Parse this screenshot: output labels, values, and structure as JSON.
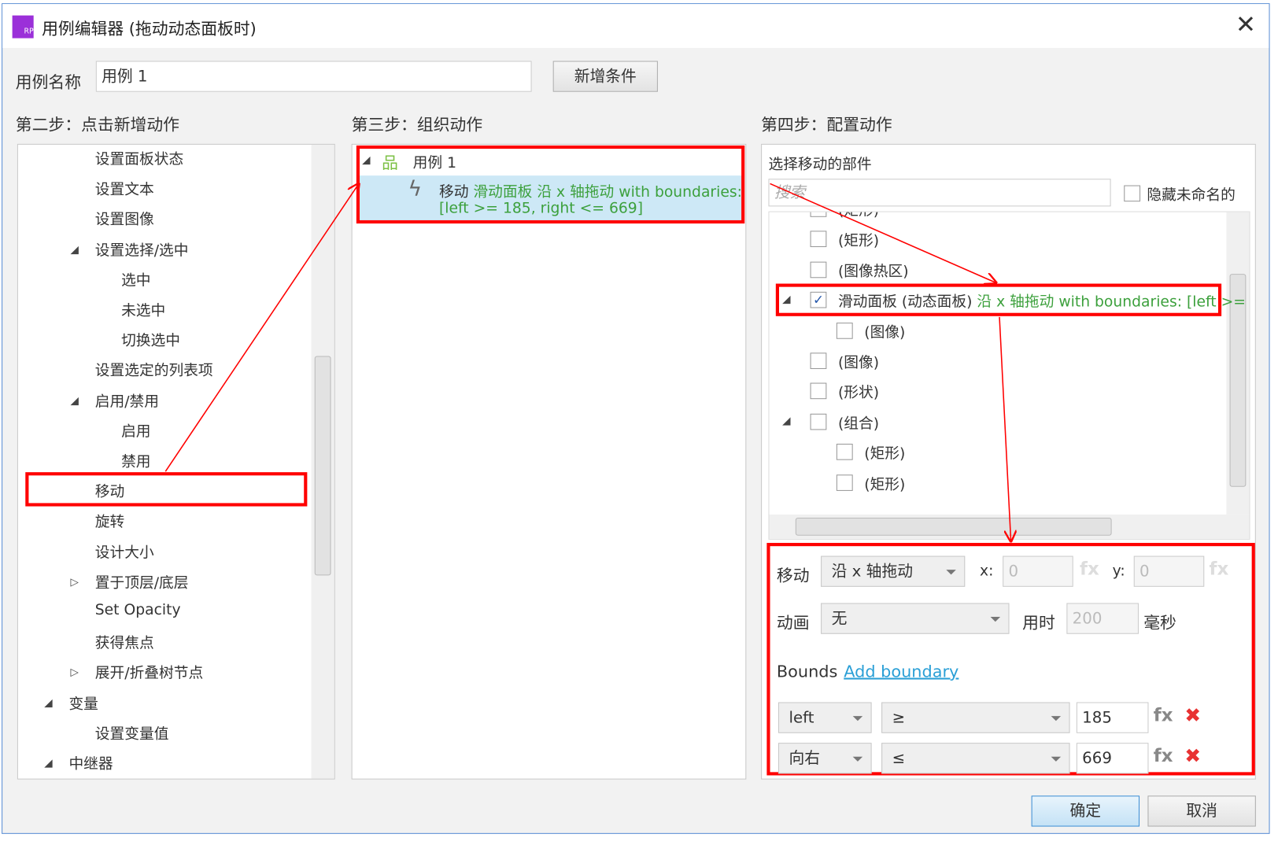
{
  "window": {
    "title": "用例编辑器 (拖动动态面板时)",
    "close_icon": "close-icon"
  },
  "case_name": {
    "label": "用例名称",
    "value": "用例 1",
    "add_condition": "新增条件"
  },
  "step2": {
    "title": "第二步：点击新增动作",
    "items": [
      {
        "label": "设置面板状态",
        "level": 1
      },
      {
        "label": "设置文本",
        "level": 1
      },
      {
        "label": "设置图像",
        "level": 1
      },
      {
        "label": "设置选择/选中",
        "level": 1,
        "expander": "expanded"
      },
      {
        "label": "选中",
        "level": 2
      },
      {
        "label": "未选中",
        "level": 2
      },
      {
        "label": "切换选中",
        "level": 2
      },
      {
        "label": "设置选定的列表项",
        "level": 1
      },
      {
        "label": "启用/禁用",
        "level": 1,
        "expander": "expanded"
      },
      {
        "label": "启用",
        "level": 2
      },
      {
        "label": "禁用",
        "level": 2
      },
      {
        "label": "移动",
        "level": 1,
        "highlighted": true
      },
      {
        "label": "旋转",
        "level": 1
      },
      {
        "label": "设计大小",
        "level": 1
      },
      {
        "label": "置于顶层/底层",
        "level": 1,
        "expander": "collapsed"
      },
      {
        "label": "Set Opacity",
        "level": 1
      },
      {
        "label": "获得焦点",
        "level": 1
      },
      {
        "label": "展开/折叠树节点",
        "level": 1,
        "expander": "collapsed"
      },
      {
        "label": "变量",
        "level": 0,
        "expander": "expanded"
      },
      {
        "label": "设置变量值",
        "level": 1
      },
      {
        "label": "中继器",
        "level": 0,
        "expander": "expanded"
      }
    ]
  },
  "step3": {
    "title": "第三步：组织动作",
    "case": "用例 1",
    "action_verb": "移动",
    "action_detail": "滑动面板 沿 x 轴拖动 with boundaries:",
    "action_detail2": "[left >= 185, right <= 669]"
  },
  "step4": {
    "title": "第四步：配置动作",
    "widget_header": "选择移动的部件",
    "search_placeholder": "搜索",
    "hide_unnamed": "隐藏未命名的",
    "tree": [
      {
        "label": "(矩形)",
        "level": 0,
        "checked": false,
        "partial": true
      },
      {
        "label": "(矩形)",
        "level": 0,
        "checked": false
      },
      {
        "label": "(图像热区)",
        "level": 0,
        "checked": false
      },
      {
        "label": "滑动面板 (动态面板)",
        "suffix": "沿 x 轴拖动 with boundaries: [left >=",
        "level": 0,
        "checked": true,
        "expander": "expanded",
        "highlighted": true
      },
      {
        "label": "(图像)",
        "level": 1,
        "checked": false
      },
      {
        "label": "(图像)",
        "level": 0,
        "checked": false
      },
      {
        "label": "(形状)",
        "level": 0,
        "checked": false
      },
      {
        "label": "(组合)",
        "level": 0,
        "checked": false,
        "expander": "expanded"
      },
      {
        "label": "(矩形)",
        "level": 1,
        "checked": false
      },
      {
        "label": "(矩形)",
        "level": 1,
        "checked": false
      }
    ],
    "move_label": "移动",
    "move_value": "沿 x 轴拖动",
    "x_label": "x:",
    "x_value": "0",
    "y_label": "y:",
    "y_value": "0",
    "fx": "fx",
    "anim_label": "动画",
    "anim_value": "无",
    "time_label": "用时",
    "time_value": "200",
    "ms": "毫秒",
    "bounds_label": "Bounds",
    "add_boundary": "Add boundary",
    "bounds": [
      {
        "side": "left",
        "op": "≥",
        "value": "185"
      },
      {
        "side": "向右",
        "op": "≤",
        "value": "669"
      }
    ]
  },
  "footer": {
    "ok": "确定",
    "cancel": "取消"
  },
  "colors": {
    "highlight": "#ff0000",
    "green_text": "#3ca03c",
    "selection": "#cde8f6",
    "link": "#2a9fd6"
  }
}
